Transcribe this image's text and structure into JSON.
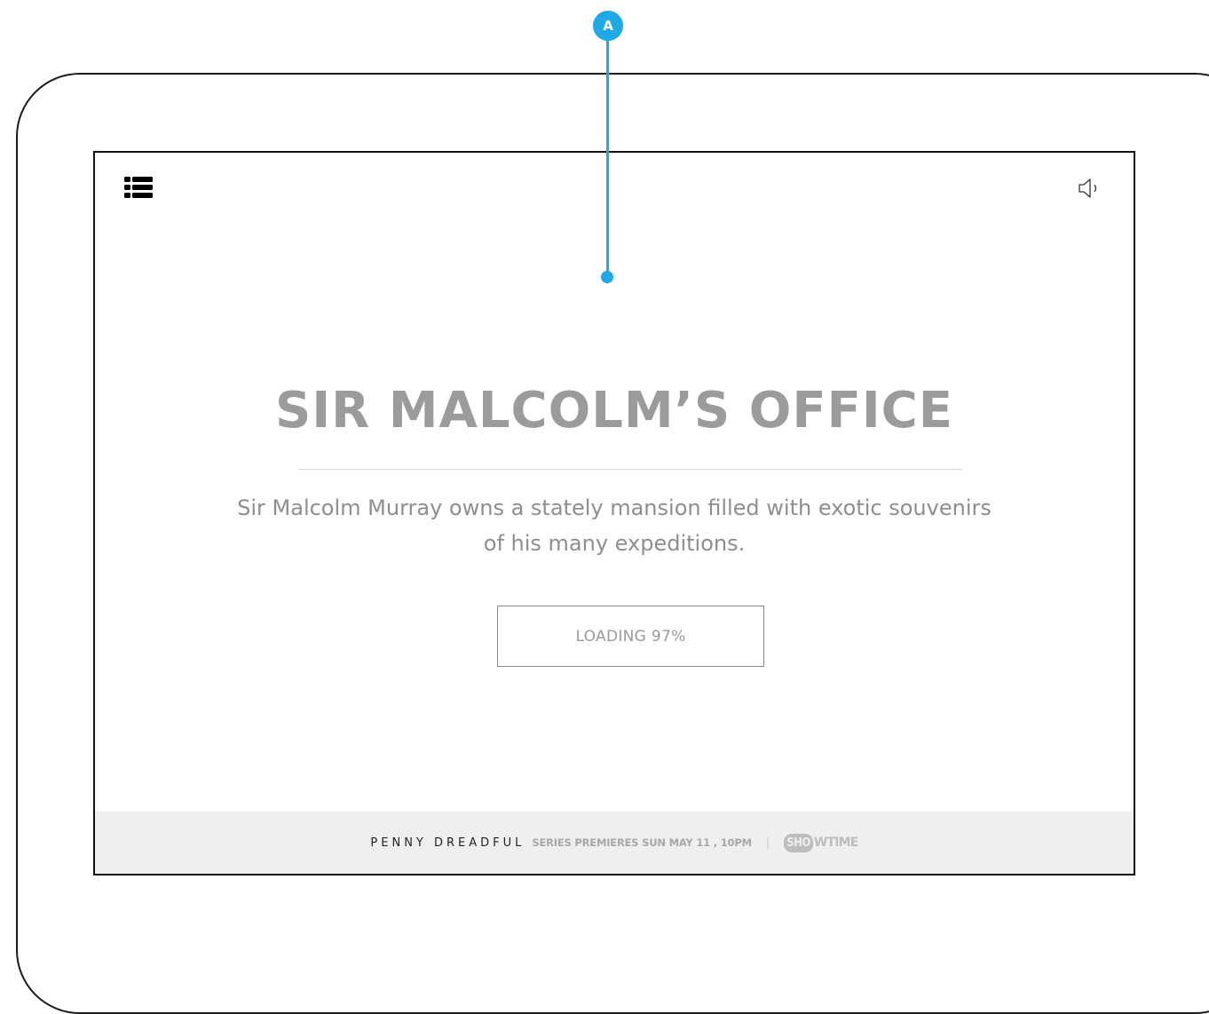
{
  "annotation": {
    "badge_label": "A",
    "accent_color": "#1fa9e6"
  },
  "toolbar": {
    "menu_icon": "list-menu-icon",
    "sound_icon": "speaker-icon"
  },
  "scene": {
    "title": "SIR MALCOLM’S OFFICE",
    "description_line1": "Sir Malcolm Murray owns a stately mansion filled with exotic souvenirs",
    "description_line2": "of his many expeditions.",
    "loading_label": "LOADING 97%",
    "loading_progress_percent": 97
  },
  "footer": {
    "show_name": "PENNY DREADFUL",
    "premiere_text": "SERIES PREMIERES SUN MAY 11 , 10PM",
    "separator": "|",
    "network_logo_part1": "SHO",
    "network_logo_part2": "WTIME"
  },
  "colors": {
    "title_gray": "#9b9b9b",
    "footer_bg": "#efefef"
  }
}
